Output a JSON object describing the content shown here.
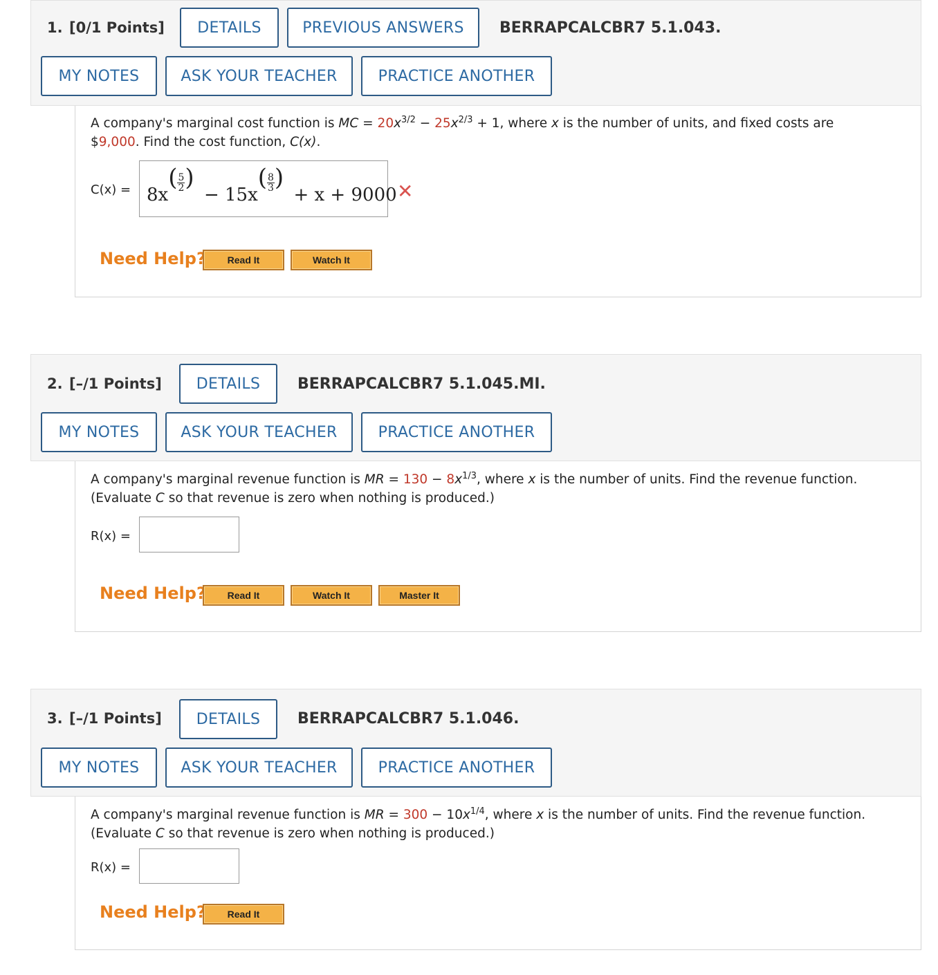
{
  "buttons": {
    "details": "DETAILS",
    "previous_answers": "PREVIOUS ANSWERS",
    "my_notes": "MY NOTES",
    "ask_teacher": "ASK YOUR TEACHER",
    "practice_another": "PRACTICE ANOTHER"
  },
  "help": {
    "need_help": "Need Help?",
    "read_it": "Read It",
    "watch_it": "Watch It",
    "master_it": "Master It"
  },
  "q1": {
    "number": "1.",
    "points": "[0/1 Points]",
    "code": "BERRAPCALCBR7 5.1.043.",
    "p_a": "A company's marginal cost function is ",
    "p_mc": "MC",
    "p_eq": " = ",
    "p_c1": "20",
    "p_x1": "x",
    "p_e1": "3/2",
    "p_minus": " − ",
    "p_c2": "25",
    "p_x2": "x",
    "p_e2": "2/3",
    "p_b": " + 1, where ",
    "p_x": "x",
    "p_c": " is the number of units, and fixed costs are",
    "p_d": "$",
    "p_fixed": "9,000",
    "p_e": ". Find the cost function, ",
    "p_cx": "C(x)",
    "p_f": ".",
    "answer_label": "C(x) =",
    "ans_t1": "8x",
    "ans_f1n": "5",
    "ans_f1d": "2",
    "ans_mid": "− 15x",
    "ans_f2n": "8",
    "ans_f2d": "3",
    "ans_end": "+ x + 9000",
    "status": "incorrect"
  },
  "q2": {
    "number": "2.",
    "points": "[–/1 Points]",
    "code": "BERRAPCALCBR7 5.1.045.MI.",
    "p_a": "A company's marginal revenue function is ",
    "p_mr": "MR",
    "p_eq": " = ",
    "p_c1": "130",
    "p_minus": " − ",
    "p_c2": "8",
    "p_x1": "x",
    "p_e1": "1/3",
    "p_b": ", where ",
    "p_x": "x",
    "p_c": " is the number of units. Find the revenue function.",
    "p_line2a": "(Evaluate ",
    "p_C": "C",
    "p_line2b": " so that revenue is zero when nothing is produced.)",
    "answer_label": "R(x) ="
  },
  "q3": {
    "number": "3.",
    "points": "[–/1 Points]",
    "code": "BERRAPCALCBR7 5.1.046.",
    "p_a": "A company's marginal revenue function is ",
    "p_mr": "MR",
    "p_eq": " = ",
    "p_c1": "300",
    "p_minus": " − ",
    "p_c2": "10",
    "p_x1": "x",
    "p_e1": "1/4",
    "p_b": ", where ",
    "p_x": "x",
    "p_c": " is the number of units. Find the revenue function.",
    "p_line2a": "(Evaluate ",
    "p_C": "C",
    "p_line2b": " so that revenue is zero when nothing is produced.)",
    "answer_label": "R(x) ="
  },
  "colors": {
    "accent": "#2d6aa3",
    "red_value": "#c0392b",
    "help_orange": "#e8801e",
    "incorrect": "#d9534f"
  },
  "icons": {
    "incorrect": "close-x-icon"
  }
}
